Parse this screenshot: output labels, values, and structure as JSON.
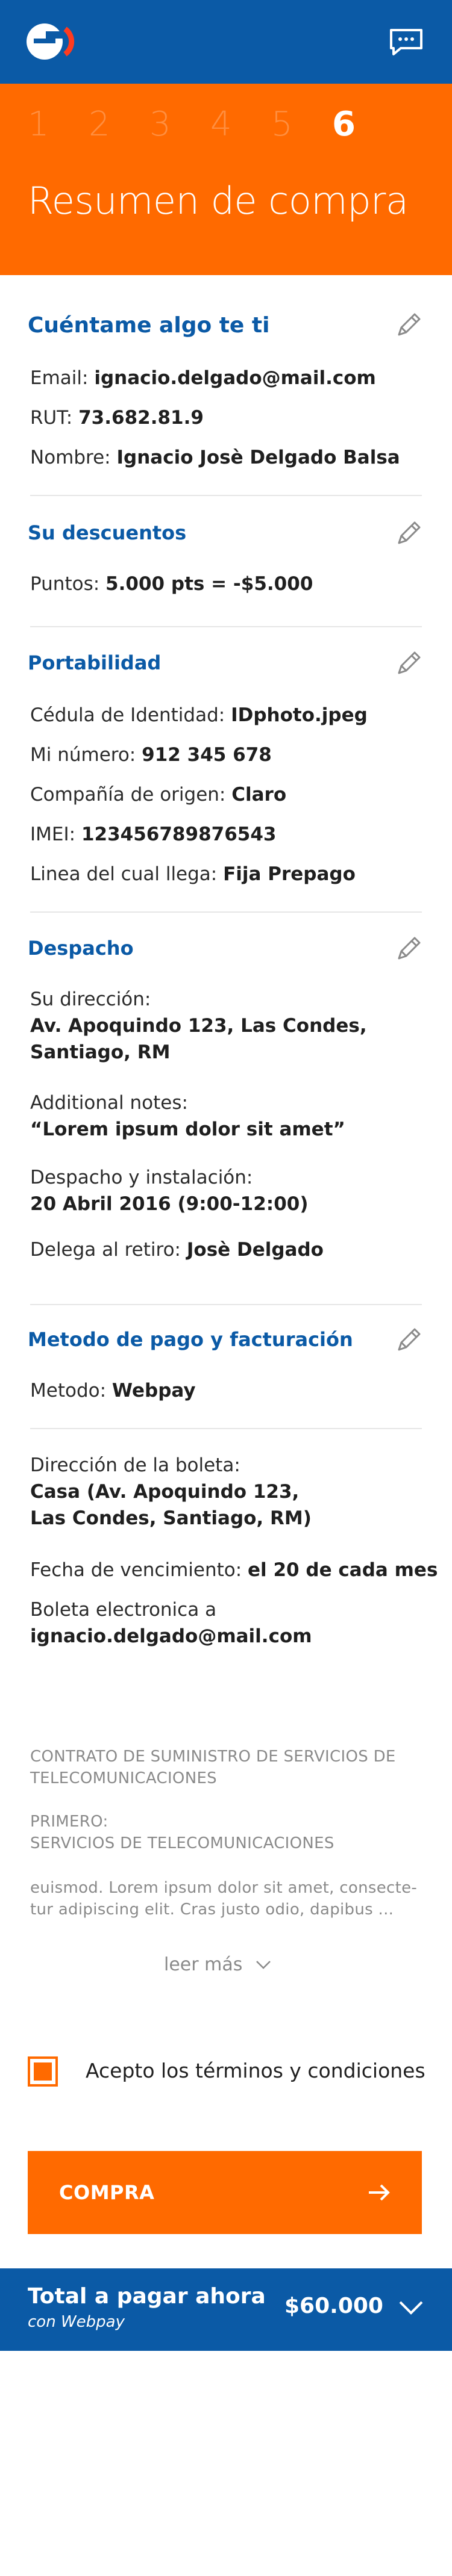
{
  "colors": {
    "brand_blue": "#0b5aa6",
    "brand_orange": "#ff6a00"
  },
  "header": {
    "logo_icon": "entel-logo-icon",
    "chat_icon": "chat-icon"
  },
  "steps": [
    "1",
    "2",
    "3",
    "4",
    "5",
    "6"
  ],
  "active_step": "6",
  "page_title": "Resumen de compra",
  "sections": {
    "personal": {
      "title": "Cuéntame algo te ti",
      "email_label": "Email:",
      "email_value": "ignacio.delgado@mail.com",
      "rut_label": "RUT:",
      "rut_value": "73.682.81.9",
      "name_label": "Nombre:",
      "name_value": "Ignacio Josè Delgado Balsa"
    },
    "discounts": {
      "title": "Su descuentos",
      "points_label": "Puntos:",
      "points_value": "5.000 pts = -$5.000"
    },
    "portability": {
      "title": "Portabilidad",
      "id_label": "Cédula de Identidad:",
      "id_value": "IDphoto.jpeg",
      "number_label": "Mi número:",
      "number_value": "912 345 678",
      "origin_label": "Compañía de origen:",
      "origin_value": "Claro",
      "imei_label": "IMEI:",
      "imei_value": "123456789876543",
      "line_label": "Linea del cual llega:",
      "line_value": "Fija Prepago"
    },
    "shipping": {
      "title": "Despacho",
      "address_label": "Su dirección:",
      "address_value_1": "Av. Apoquindo 123, Las Condes,",
      "address_value_2": "Santiago, RM",
      "notes_label": "Additional notes:",
      "notes_value": "“Lorem ipsum dolor sit amet”",
      "install_label": "Despacho y instalación:",
      "install_value": "20 Abril 2016 (9:00-12:00)",
      "pickup_label": "Delega al retiro:",
      "pickup_value": "Josè Delgado"
    },
    "payment": {
      "title": "Metodo de pago y facturación",
      "method_label": "Metodo:",
      "method_value": "Webpay",
      "bill_address_label": "Dirección de la boleta:",
      "bill_address_value_1": "Casa (Av. Apoquindo 123,",
      "bill_address_value_2": "Las Condes, Santiago, RM)",
      "due_label": "Fecha de vencimiento:",
      "due_value": "el 20 de cada mes",
      "ebill_label": "Boleta electronica a",
      "ebill_value": "ignacio.delgado@mail.com"
    }
  },
  "contract": {
    "line1": "CONTRATO DE SUMINISTRO DE SERVICIOS DE",
    "line2": "TELECOMUNICACIONES",
    "line3": "PRIMERO:",
    "line4": "SERVICIOS DE TELECOMUNICACIONES",
    "line5": "euismod. Lorem ipsum dolor sit amet, consecte-",
    "line6": "tur adipiscing elit. Cras justo odio, dapibus ...",
    "read_more": "leer más"
  },
  "terms": {
    "label": "Acepto los términos y condiciones",
    "checked": true
  },
  "buy_button": {
    "label": "COMPRA",
    "icon": "arrow-right-icon"
  },
  "footer": {
    "title": "Total a pagar ahora",
    "subtitle": "con Webpay",
    "total": "$60.000",
    "icon": "chevron-down-icon"
  }
}
